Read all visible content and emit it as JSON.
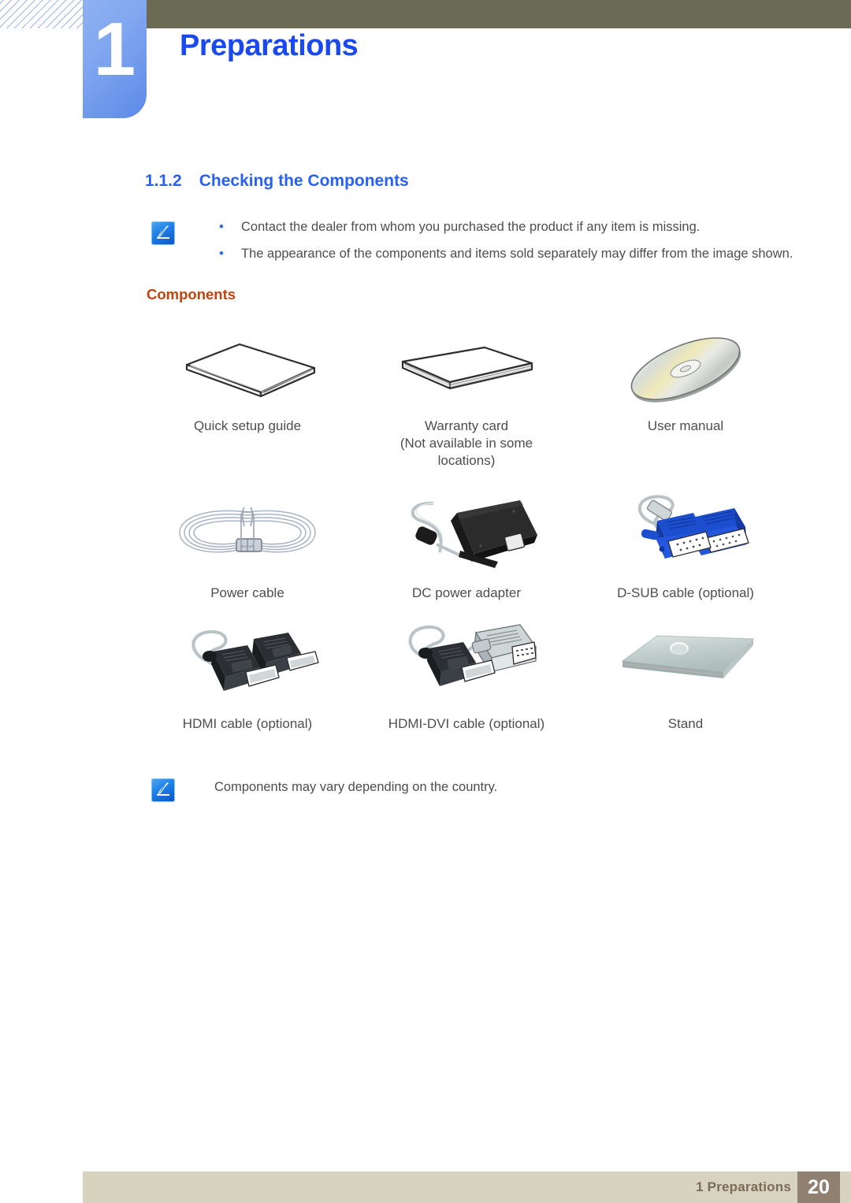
{
  "header": {
    "chapter_number": "1",
    "chapter_title": "Preparations",
    "accent_blue": "#1a49ef",
    "tab_blue": "#7aa3f0",
    "olive": "#6b6a54"
  },
  "section": {
    "number": "1.1.2",
    "title": "Checking the Components",
    "color": "#2861f2"
  },
  "notes": {
    "top": {
      "icon": "note-pen-icon",
      "bullets": [
        "Contact the dealer from whom you purchased the product if any item is missing.",
        "The appearance of the components and items sold separately may differ from the image shown."
      ]
    },
    "bottom": {
      "icon": "note-pen-icon",
      "text": "Components may vary depending on the country."
    }
  },
  "components": {
    "heading": "Components",
    "heading_color": "#c1440e",
    "rows": [
      [
        {
          "art": "quick-setup-guide-art",
          "caption": "Quick setup guide",
          "subcaption": ""
        },
        {
          "art": "warranty-card-art",
          "caption": "Warranty card",
          "subcaption": "(Not available in some locations)"
        },
        {
          "art": "user-manual-cd-art",
          "caption": "User manual",
          "subcaption": ""
        }
      ],
      [
        {
          "art": "power-cable-art",
          "caption": "Power cable",
          "subcaption": ""
        },
        {
          "art": "dc-power-adapter-art",
          "caption": "DC power adapter",
          "subcaption": ""
        },
        {
          "art": "d-sub-cable-art",
          "caption": "D-SUB cable (optional)",
          "subcaption": ""
        }
      ],
      [
        {
          "art": "hdmi-cable-art",
          "caption": "HDMI cable (optional)",
          "subcaption": ""
        },
        {
          "art": "hdmi-dvi-cable-art",
          "caption": "HDMI-DVI cable (optional)",
          "subcaption": ""
        },
        {
          "art": "stand-art",
          "caption": "Stand",
          "subcaption": ""
        }
      ]
    ]
  },
  "footer": {
    "label": "1 Preparations",
    "page_number": "20",
    "bar_color": "#d8d3bf",
    "page_box_color": "#8f8070"
  }
}
